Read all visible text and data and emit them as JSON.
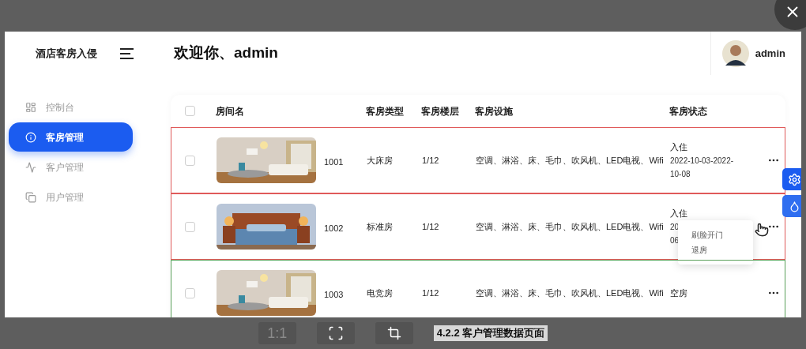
{
  "app": {
    "brand": "酒店客房入侵",
    "title": "欢迎你、admin",
    "user": "admin"
  },
  "sidebar": {
    "items": [
      {
        "label": "控制台",
        "selected": false
      },
      {
        "label": "客房管理",
        "selected": true
      },
      {
        "label": "客户管理",
        "selected": false
      },
      {
        "label": "用户管理",
        "selected": false
      }
    ]
  },
  "table": {
    "all_checked": false,
    "columns": [
      "房间名",
      "客房类型",
      "客房楼层",
      "客房设施",
      "客房状态"
    ],
    "rows": [
      {
        "checked": false,
        "room": "1001",
        "type": "大床房",
        "floor": "1/12",
        "facilities": "空调、淋浴、床、毛巾、吹风机、LED电视、Wifi",
        "status": [
          "入住",
          "2022-10-03-2022-",
          "10-08"
        ],
        "color": "#e05a5a"
      },
      {
        "checked": false,
        "room": "1002",
        "type": "标准房",
        "floor": "1/12",
        "facilities": "空调、淋浴、床、毛巾、吹风机、LED电视、Wifi",
        "status": [
          "入住",
          "20",
          "06"
        ],
        "color": "#e05a5a",
        "menu": [
          "刷脸开门",
          "退房"
        ]
      },
      {
        "checked": false,
        "room": "1003",
        "type": "电竞房",
        "floor": "1/12",
        "facilities": "空调、淋浴、床、毛巾、吹风机、LED电视、Wifi",
        "status": [
          "空房"
        ],
        "color": "#5aa05a"
      }
    ]
  },
  "viewer": {
    "buttons": [
      "1:1"
    ],
    "caption": "4.2.2 客户管理数据页面"
  }
}
